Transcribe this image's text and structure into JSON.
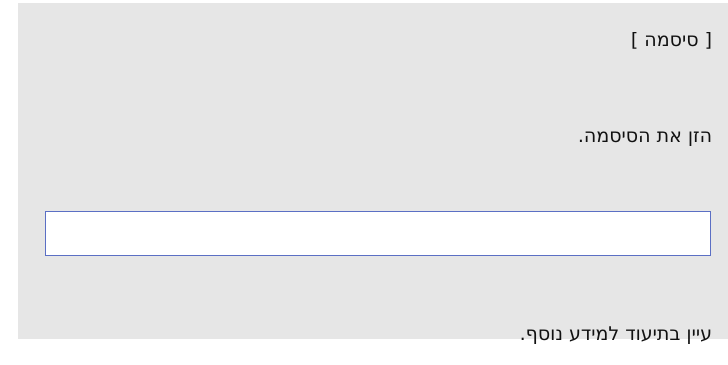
{
  "dialog": {
    "title": "[ סיסמה ]",
    "prompt": "הזן את הסיסמה.",
    "password_value": "",
    "help_text": "עיין בתיעוד למידע נוסף."
  },
  "colors": {
    "panel_background": "#e6e6e6",
    "field_border": "#5b6fc4",
    "field_background": "#ffffff"
  }
}
